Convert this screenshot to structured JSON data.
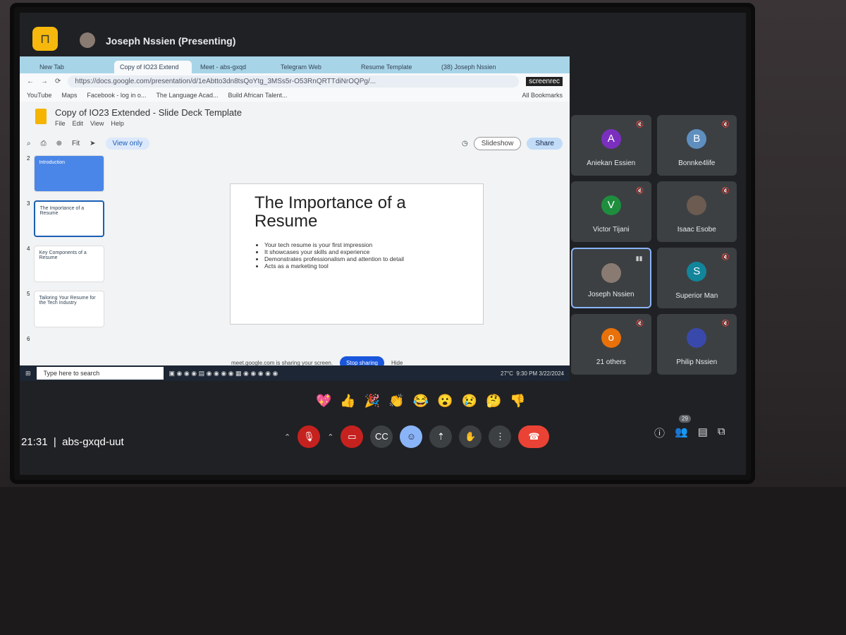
{
  "meet": {
    "presenter": "Joseph Nssien (Presenting)",
    "clock": "21:31",
    "meeting_code": "abs-gxqd-uut",
    "participant_count": "29"
  },
  "browser": {
    "tabs": [
      "New Tab",
      "Copy of IO23 Extend",
      "Meet - abs-gxqd",
      "Telegram Web",
      "Resume Template",
      "(38) Joseph Nssien"
    ],
    "overlay_label": "screenrec",
    "url": "https://docs.google.com/presentation/d/1eAbtto3dn8tsQoYtg_3MSs5r-O53RnQRTTdiNrOQPg/...",
    "bookmarks": [
      "YouTube",
      "Maps",
      "Facebook - log in o...",
      "The Language Acad...",
      "Build African Talent..."
    ],
    "all_bookmarks": "All Bookmarks"
  },
  "slides": {
    "title": "Copy of IO23 Extended - Slide Deck Template",
    "menu": [
      "File",
      "Edit",
      "View",
      "Help"
    ],
    "zoom": "Fit",
    "view_only": "View only",
    "slideshow": "Slideshow",
    "share": "Share",
    "thumbs": [
      {
        "n": "2",
        "title": "Introduction"
      },
      {
        "n": "3",
        "title": "The Importance of a Resume"
      },
      {
        "n": "4",
        "title": "Key Components of a Resume"
      },
      {
        "n": "5",
        "title": "Tailoring Your Resume for the Tech Industry"
      },
      {
        "n": "6",
        "title": ""
      }
    ],
    "current": {
      "title": "The Importance of a Resume",
      "bullets": [
        "Your tech resume is your first impression",
        "It showcases your skills and experience",
        "Demonstrates professionalism and attention to detail",
        "Acts as a marketing tool"
      ]
    },
    "share_notice": "meet.google.com is sharing your screen.",
    "stop_sharing": "Stop sharing",
    "hide": "Hide"
  },
  "taskbar": {
    "search_placeholder": "Type here to search",
    "weather": "27°C",
    "time": "9:30 PM",
    "date": "3/22/2024"
  },
  "participants": [
    {
      "name": "Aniekan Essien",
      "initial": "A",
      "color": "#7b2fbf"
    },
    {
      "name": "Bonnke4life",
      "initial": "B",
      "color": "#5f8fbf"
    },
    {
      "name": "Victor Tijani",
      "initial": "V",
      "color": "#1e8e3e"
    },
    {
      "name": "Isaac Esobe",
      "initial": "",
      "color": "#6b5b50"
    },
    {
      "name": "Joseph Nssien",
      "initial": "",
      "color": "#8a7b72"
    },
    {
      "name": "Superior Man",
      "initial": "S",
      "color": "#12859b"
    },
    {
      "name": "21 others",
      "initial": "o",
      "color": "#e8710a"
    },
    {
      "name": "Philip Nssien",
      "initial": "",
      "color": "#3949ab"
    }
  ],
  "reactions": [
    "💖",
    "👍",
    "🎉",
    "👏",
    "😂",
    "😮",
    "😢",
    "🤔",
    "👎"
  ]
}
